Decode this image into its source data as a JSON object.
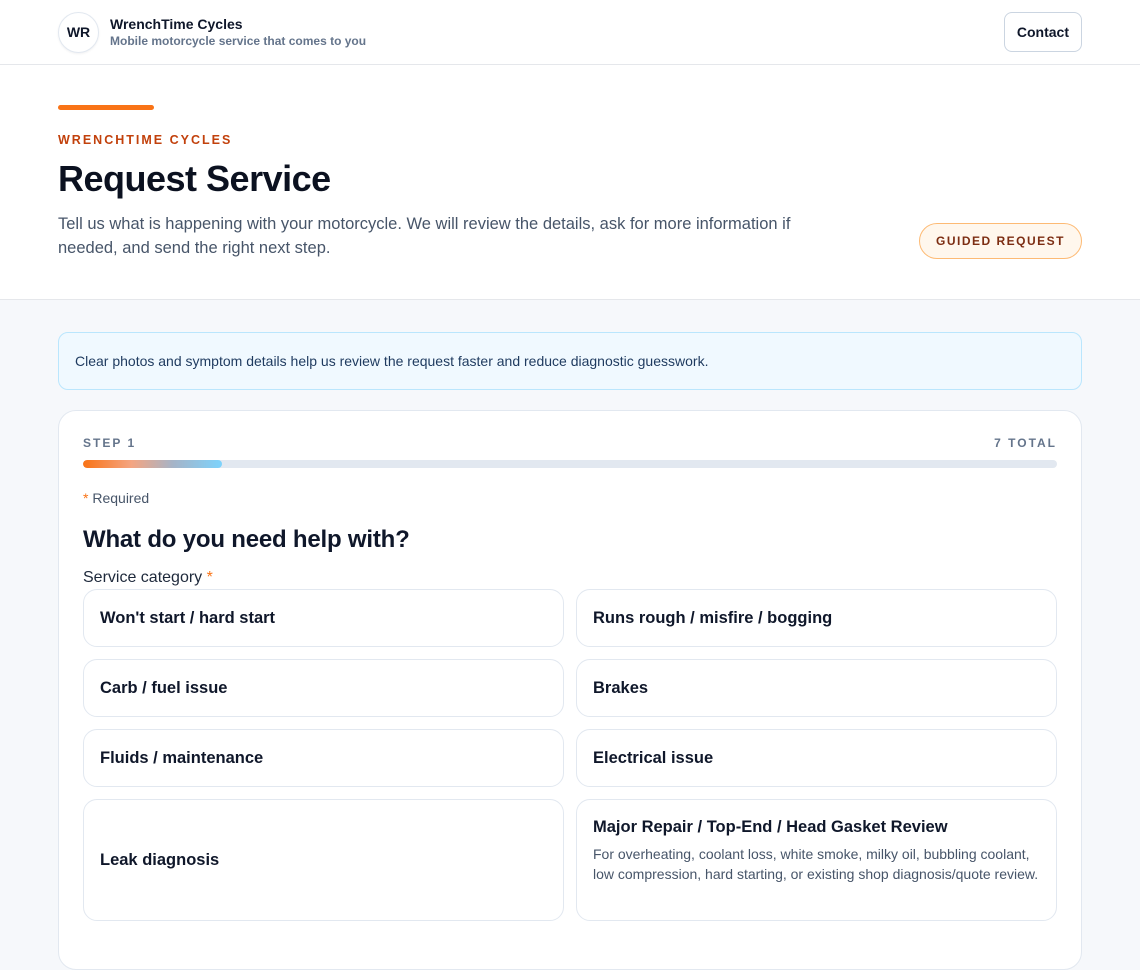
{
  "header": {
    "logo_initials": "WR",
    "brand_name": "WrenchTime Cycles",
    "tagline": "Mobile motorcycle service that comes to you",
    "contact_label": "Contact"
  },
  "hero": {
    "eyebrow": "WRENCHTIME CYCLES",
    "title": "Request Service",
    "description": "Tell us what is happening with your motorcycle. We will review the details, ask for more information if needed, and send the right next step.",
    "badge": "GUIDED REQUEST"
  },
  "notice": {
    "text": "Clear photos and symptom details help us review the request faster and reduce diagnostic guesswork."
  },
  "form": {
    "step_label": "STEP 1",
    "total_label": "7 TOTAL",
    "progress": 0.143,
    "required_star": "*",
    "required_text": "Required",
    "question": "What do you need help with?",
    "field_label": "Service category",
    "options": [
      {
        "label": "Won't start / hard start"
      },
      {
        "label": "Runs rough / misfire / bogging"
      },
      {
        "label": "Carb / fuel issue"
      },
      {
        "label": "Brakes"
      },
      {
        "label": "Fluids / maintenance"
      },
      {
        "label": "Electrical issue"
      },
      {
        "label": "Leak diagnosis"
      },
      {
        "label": "Major Repair / Top-End / Head Gasket Review",
        "description": "For overheating, coolant loss, white smoke, milky oil, bubbling coolant, low compression, hard starting, or existing shop diagnosis/quote review."
      }
    ]
  },
  "colors": {
    "accent": "#f97316",
    "eyebrow": "#c2410c",
    "notice_bg": "#f0f9ff",
    "notice_border": "#bae6fd"
  }
}
